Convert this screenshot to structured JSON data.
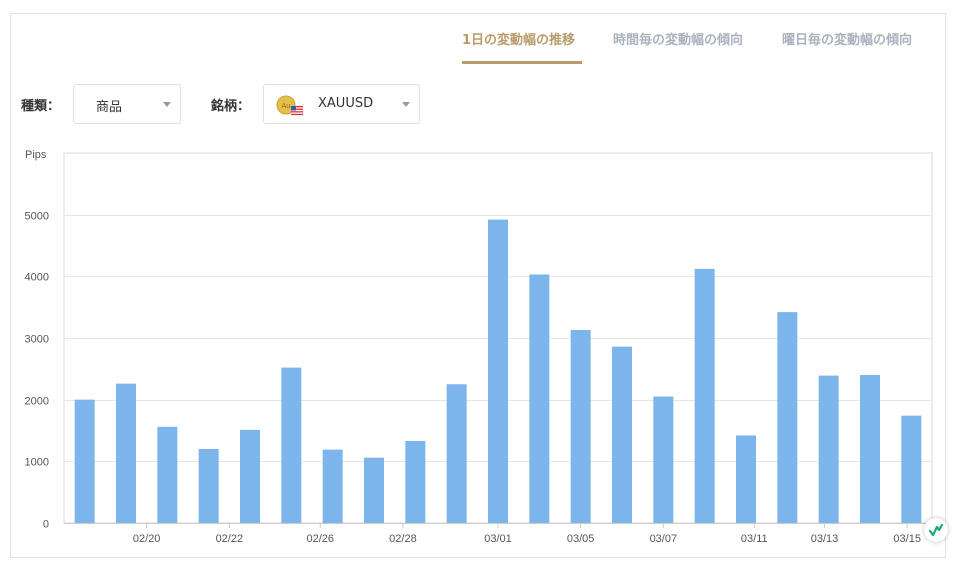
{
  "tabs": [
    {
      "label": "1日の変動幅の推移",
      "active": true
    },
    {
      "label": "時間毎の変動幅の傾向",
      "active": false
    },
    {
      "label": "曜日毎の変動幅の傾向",
      "active": false
    }
  ],
  "filters": {
    "type_label": "種類：",
    "type_value": "商品",
    "symbol_label": "銘柄：",
    "symbol_value": "XAUUSD",
    "symbol_icon": "gold-coin-us-flag-icon",
    "coin_text": "Au"
  },
  "colors": {
    "accent": "#b89c6a",
    "bar": "#7cb5ec",
    "tab_inactive": "#aab2bd"
  },
  "chart_data": {
    "type": "bar",
    "ylabel": "Pips",
    "ylim": [
      0,
      6000
    ],
    "yticks": [
      0,
      1000,
      2000,
      3000,
      4000,
      5000
    ],
    "values": [
      2000,
      2260,
      1560,
      1200,
      1510,
      2520,
      1190,
      1060,
      1330,
      2250,
      4920,
      4030,
      3130,
      2860,
      2050,
      4120,
      1420,
      3420,
      2390,
      2400,
      1740
    ],
    "xtick_labels": [
      {
        "index": 1.5,
        "label": "02/20"
      },
      {
        "index": 3.5,
        "label": "02/22"
      },
      {
        "index": 5.7,
        "label": "02/26"
      },
      {
        "index": 7.7,
        "label": "02/28"
      },
      {
        "index": 10,
        "label": "03/01"
      },
      {
        "index": 12,
        "label": "03/05"
      },
      {
        "index": 14,
        "label": "03/07"
      },
      {
        "index": 16.2,
        "label": "03/11"
      },
      {
        "index": 17.9,
        "label": "03/13"
      },
      {
        "index": 19.9,
        "label": "03/15"
      }
    ],
    "grid": true
  }
}
